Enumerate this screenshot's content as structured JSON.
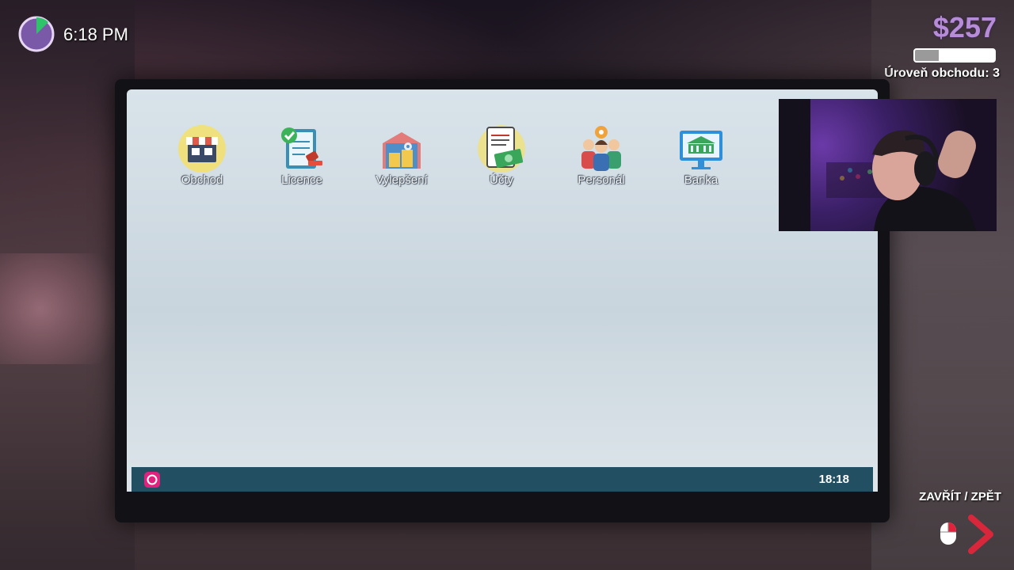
{
  "hud": {
    "time": "6:18 PM",
    "money": "$257",
    "shop_level_label": "Úroveň obchodu: 3",
    "level_progress": 0.3,
    "close_back_label": "ZAVŘÍT / ZPĚT"
  },
  "desktop": {
    "icons": [
      {
        "label": "Obchod",
        "icon": "shop-icon"
      },
      {
        "label": "Licence",
        "icon": "license-icon"
      },
      {
        "label": "Vylepšení",
        "icon": "upgrade-icon"
      },
      {
        "label": "Účty",
        "icon": "bills-icon"
      },
      {
        "label": "Personál",
        "icon": "staff-icon"
      },
      {
        "label": "Banka",
        "icon": "bank-icon"
      }
    ]
  },
  "taskbar": {
    "clock": "18:18"
  },
  "colors": {
    "money": "#b68cd8",
    "taskbar": "#234f63",
    "start_button": "#e0227e",
    "arrow": "#d8273a"
  }
}
